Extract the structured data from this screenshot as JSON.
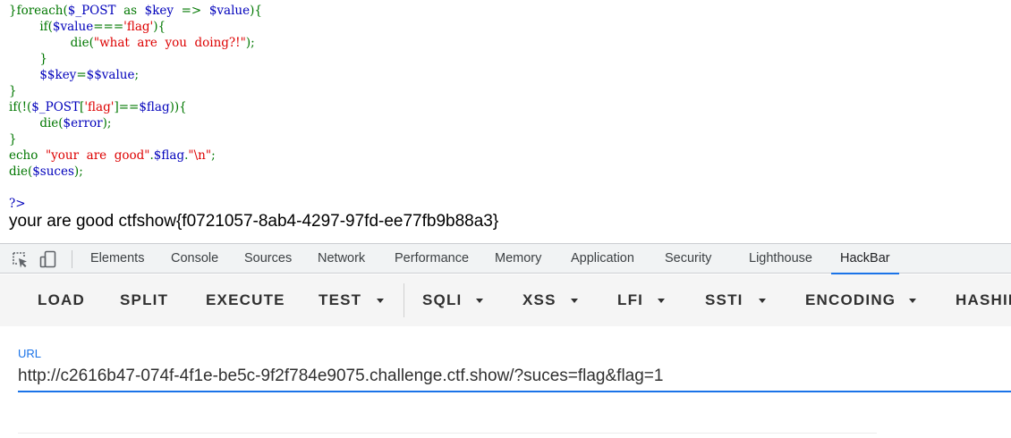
{
  "code": {
    "lines": [
      [
        {
          "t": "}foreach(",
          "c": "g"
        },
        {
          "t": "$_POST",
          "c": "b"
        },
        {
          "t": "  as  ",
          "c": "g"
        },
        {
          "t": "$key",
          "c": "b"
        },
        {
          "t": "  =>  ",
          "c": "g"
        },
        {
          "t": "$value",
          "c": "b"
        },
        {
          "t": "){",
          "c": "g"
        }
      ],
      [
        {
          "t": "        if(",
          "c": "g"
        },
        {
          "t": "$value",
          "c": "b"
        },
        {
          "t": "===",
          "c": "g"
        },
        {
          "t": "'flag'",
          "c": "r"
        },
        {
          "t": "){",
          "c": "g"
        }
      ],
      [
        {
          "t": "                die(",
          "c": "g"
        },
        {
          "t": "\"what  are  you  doing?!\"",
          "c": "r"
        },
        {
          "t": ");",
          "c": "g"
        }
      ],
      [
        {
          "t": "        }",
          "c": "g"
        }
      ],
      [
        {
          "t": "        $$key",
          "c": "b"
        },
        {
          "t": "=",
          "c": "g"
        },
        {
          "t": "$$value",
          "c": "b"
        },
        {
          "t": ";",
          "c": "g"
        }
      ],
      [
        {
          "t": "}",
          "c": "g"
        }
      ],
      [
        {
          "t": "if(!(",
          "c": "g"
        },
        {
          "t": "$_POST",
          "c": "b"
        },
        {
          "t": "[",
          "c": "g"
        },
        {
          "t": "'flag'",
          "c": "r"
        },
        {
          "t": "]==",
          "c": "g"
        },
        {
          "t": "$flag",
          "c": "b"
        },
        {
          "t": ")){",
          "c": "g"
        }
      ],
      [
        {
          "t": "        die(",
          "c": "g"
        },
        {
          "t": "$error",
          "c": "b"
        },
        {
          "t": ");",
          "c": "g"
        }
      ],
      [
        {
          "t": "}",
          "c": "g"
        }
      ],
      [
        {
          "t": "echo  ",
          "c": "g"
        },
        {
          "t": "\"your  are  good\"",
          "c": "r"
        },
        {
          "t": ".",
          "c": "g"
        },
        {
          "t": "$flag",
          "c": "b"
        },
        {
          "t": ".",
          "c": "g"
        },
        {
          "t": "\"\\n\"",
          "c": "r"
        },
        {
          "t": ";",
          "c": "g"
        }
      ],
      [
        {
          "t": "die(",
          "c": "g"
        },
        {
          "t": "$suces",
          "c": "b"
        },
        {
          "t": ");",
          "c": "g"
        }
      ],
      [],
      [
        {
          "t": "?>",
          "c": "b"
        }
      ]
    ]
  },
  "output_text": "your are good ctfshow{f0721057-8ab4-4297-97fd-ee77fb9b88a3}",
  "devtools": {
    "icons": [
      "inspect-element-icon",
      "device-toolbar-icon"
    ],
    "tabs": [
      "Elements",
      "Console",
      "Sources",
      "Network",
      "Performance",
      "Memory",
      "Application",
      "Security",
      "Lighthouse",
      "HackBar"
    ],
    "active_tab": "HackBar",
    "accent_color": "#1a73e8"
  },
  "hackbar": {
    "buttons": [
      "LOAD",
      "SPLIT",
      "EXECUTE",
      "TEST",
      "SQLI",
      "XSS",
      "LFI",
      "SSTI",
      "ENCODING",
      "HASHING"
    ],
    "dropdown_buttons": [
      "TEST",
      "SQLI",
      "XSS",
      "LFI",
      "SSTI",
      "ENCODING"
    ],
    "url_label": "URL",
    "url_value": "http://c2616b47-074f-4f1e-be5c-9f2f784e9075.challenge.ctf.show/?suces=flag&flag=1"
  },
  "colors": {
    "code_green": "#007700",
    "code_blue": "#0000bb",
    "code_red": "#dd0000"
  }
}
